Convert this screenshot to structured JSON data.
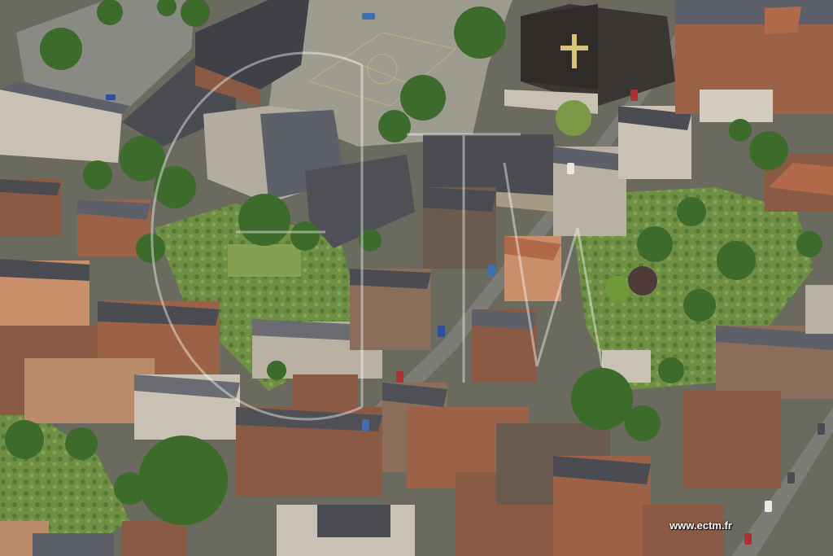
{
  "photo": {
    "subject": "aerial-photo",
    "credit": "www.ectm.fr",
    "watermark": "ECTM",
    "palette": {
      "roof_dark": "#4a4c52",
      "roof_slate": "#5d6068",
      "roof_red": "#b06a4a",
      "brick": "#8a5a44",
      "wall_light": "#c9c2b4",
      "asphalt": "#7d7c77",
      "courtyard": "#9e9c8f",
      "tree": "#3d6b2c",
      "garden": "#6f8f45",
      "grass": "#86a052"
    }
  }
}
